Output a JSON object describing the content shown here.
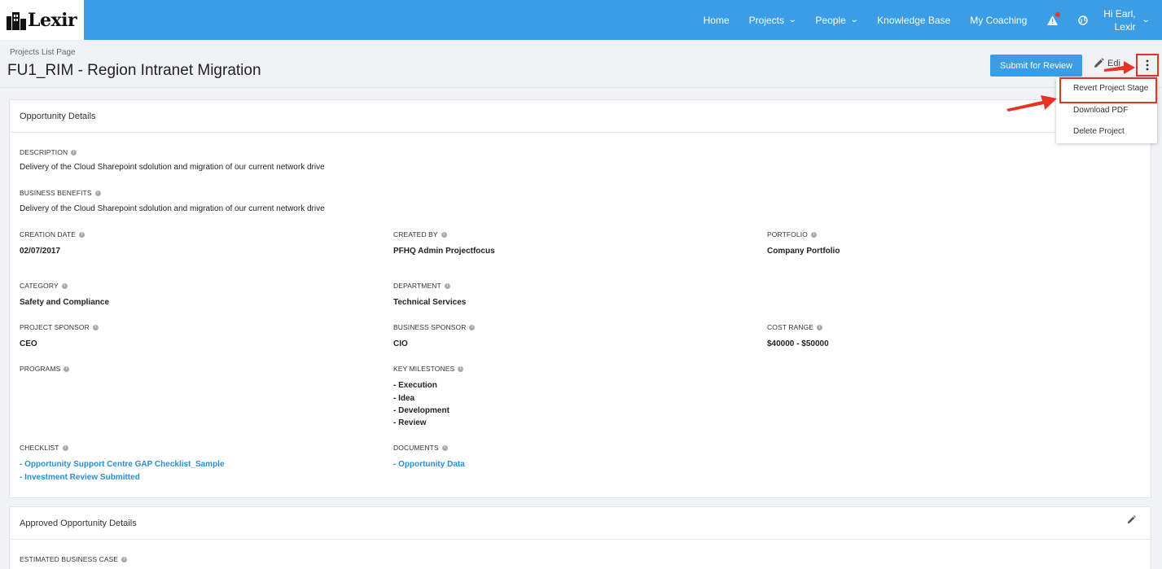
{
  "app": {
    "logo": "Lexir"
  },
  "nav": {
    "home": "Home",
    "projects": "Projects",
    "people": "People",
    "knowledge_base": "Knowledge Base",
    "my_coaching": "My Coaching",
    "user_line1": "Hi Earl,",
    "user_line2": "Lexir"
  },
  "header": {
    "breadcrumb": "Projects List Page",
    "title": "FU1_RIM - Region Intranet Migration",
    "submit_label": "Submit for Review",
    "edit_label": "Edi"
  },
  "menu": {
    "items": [
      "Revert Project Stage",
      "Download PDF",
      "Delete Project"
    ]
  },
  "opportunity": {
    "heading": "Opportunity Details",
    "description_label": "DESCRIPTION",
    "description": "Delivery of the Cloud Sharepoint sdolution and migration of our current network drive",
    "benefits_label": "BUSINESS BENEFITS",
    "benefits": "Delivery of the Cloud Sharepoint sdolution and migration of our current network drive",
    "creation_date_label": "CREATION DATE",
    "creation_date": "02/07/2017",
    "created_by_label": "CREATED BY",
    "created_by": "PFHQ Admin Projectfocus",
    "portfolio_label": "PORTFOLIO",
    "portfolio": "Company Portfolio",
    "category_label": "CATEGORY",
    "category": "Safety and Compliance",
    "department_label": "DEPARTMENT",
    "department": "Technical Services",
    "project_sponsor_label": "PROJECT SPONSOR",
    "project_sponsor": "CEO",
    "business_sponsor_label": "BUSINESS SPONSOR",
    "business_sponsor": "CIO",
    "cost_range_label": "COST RANGE",
    "cost_range": "$40000 - $50000",
    "programs_label": "PROGRAMS",
    "milestones_label": "KEY MILESTONES",
    "milestones": [
      "- Execution",
      "- Idea",
      "- Development",
      "- Review"
    ],
    "checklist_label": "CHECKLIST",
    "checklist": [
      "- Opportunity Support Centre GAP Checklist_Sample",
      "- Investment Review Submitted"
    ],
    "documents_label": "DOCUMENTS",
    "documents": [
      "- Opportunity Data"
    ]
  },
  "approved": {
    "heading": "Approved Opportunity Details",
    "estimated_label": "ESTIMATED BUSINESS CASE"
  },
  "colors": {
    "brand": "#3a9de6",
    "annotation": "#e53323",
    "link": "#2a8fd0"
  }
}
